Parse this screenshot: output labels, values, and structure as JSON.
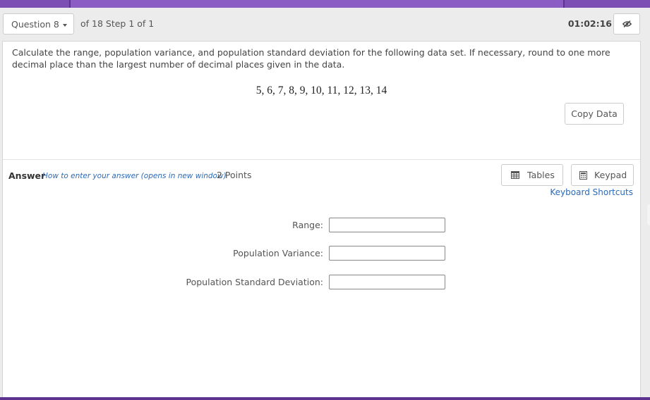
{
  "header": {
    "question_selector": "Question 8",
    "progress": "of 18 Step 1 of 1",
    "timer": "01:02:16",
    "hide_timer_icon": "eye-slash-icon"
  },
  "question": {
    "prompt": "Calculate the range, population variance, and population standard deviation for the following data set. If necessary, round to one more decimal place than the largest number of decimal places given in the data.",
    "data_set": "5, 6, 7, 8, 9, 10, 11, 12, 13, 14",
    "copy_button": "Copy Data"
  },
  "answer": {
    "label": "Answer",
    "help_link": "How to enter your answer (opens in new window)",
    "points": "2 Points",
    "tables_button": "Tables",
    "keypad_button": "Keypad",
    "keyboard_shortcuts": "Keyboard Shortcuts",
    "fields": [
      {
        "label": "Range:",
        "value": ""
      },
      {
        "label": "Population Variance:",
        "value": ""
      },
      {
        "label": "Population Standard Deviation:",
        "value": ""
      }
    ]
  },
  "colors": {
    "accent_purple": "#8a5cc4",
    "link_blue": "#2a6ab8"
  }
}
